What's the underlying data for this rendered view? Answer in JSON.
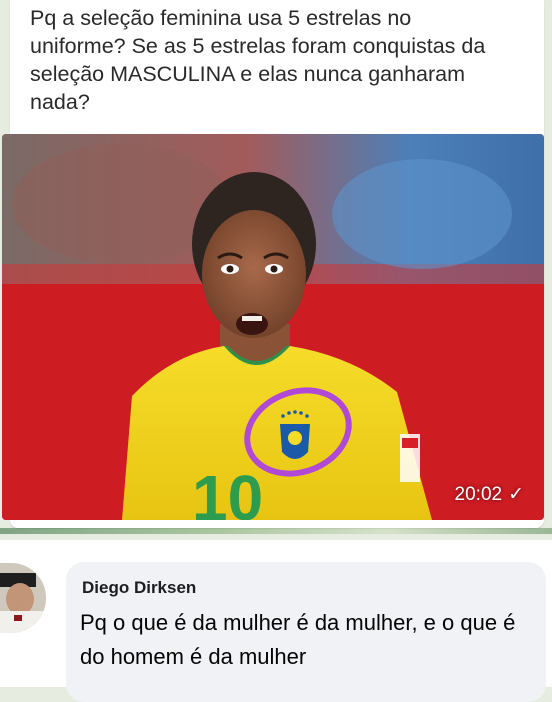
{
  "post": {
    "question": "Pq a seleção feminina usa 5 estrelas no uniforme? Se as 5 estrelas foram conquistas da seleção MASCULINA e elas nunca ganharam nada?",
    "image": {
      "jersey_number": "10",
      "timestamp": "20:02",
      "read_icon": "check-icon"
    }
  },
  "comment": {
    "author": "Diego Dirksen",
    "text": "Pq o que é da mulher é da mulher, e o que é do homem é da mulher"
  },
  "colors": {
    "jersey_yellow": "#f2d21b",
    "highlight_circle": "#b04ad6",
    "stadium_red": "#d8252a"
  }
}
